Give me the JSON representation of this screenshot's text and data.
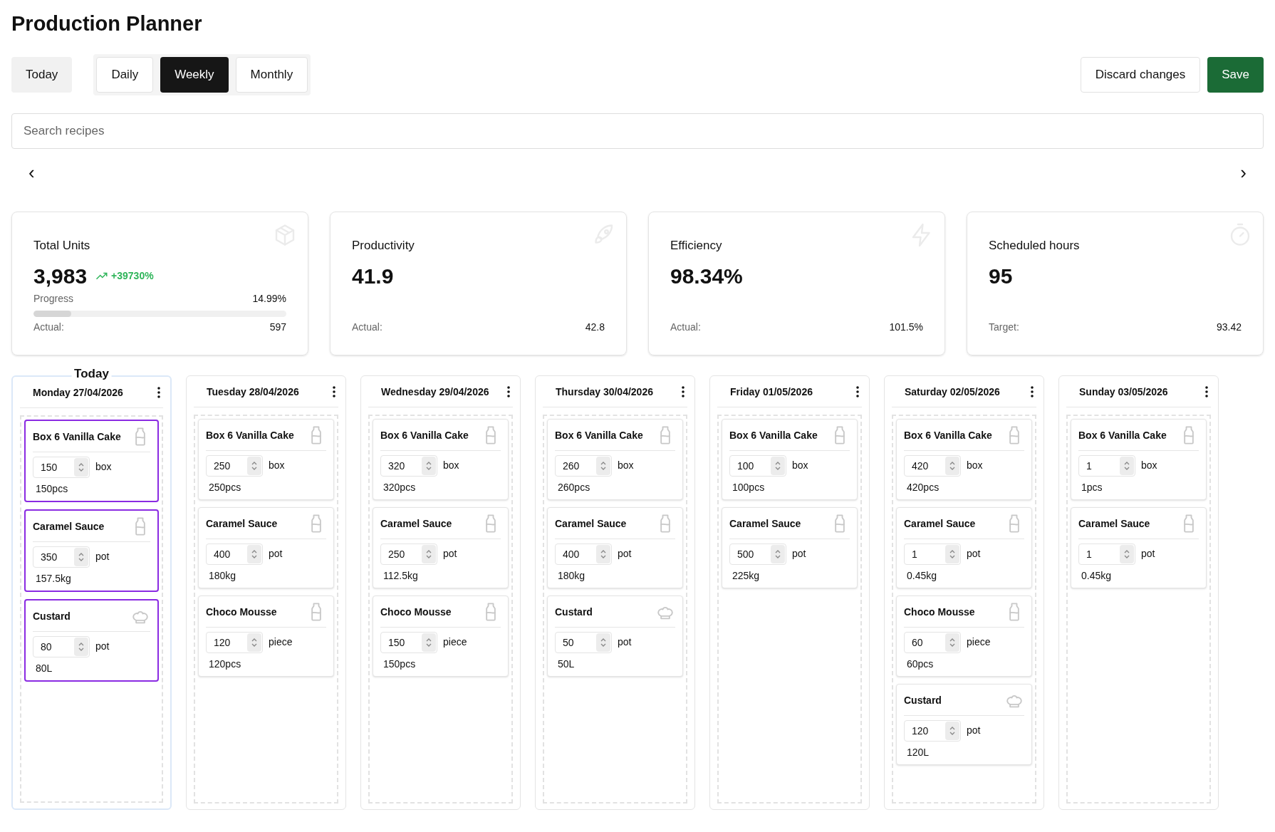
{
  "title": "Production Planner",
  "today_button": "Today",
  "tabs": [
    {
      "label": "Daily",
      "selected": false
    },
    {
      "label": "Weekly",
      "selected": true
    },
    {
      "label": "Monthly",
      "selected": false
    }
  ],
  "actions": [
    {
      "label": "Discard changes",
      "kind": "secondary"
    },
    {
      "label": "Save",
      "kind": "primary"
    }
  ],
  "search": {
    "placeholder": "Search recipes"
  },
  "nav": {
    "prev": "‹",
    "next": "›"
  },
  "stats": [
    {
      "title": "Total Units",
      "value": "3,983",
      "trend": "+39730%",
      "kind": "box",
      "progress": {
        "label": "Progress",
        "reading": "14.99%",
        "level": 0.1499
      },
      "footer_label": "Actual:",
      "footer_value": "597"
    },
    {
      "title": "Productivity",
      "value": "41.9",
      "kind": "rocket",
      "footer_label": "Actual:",
      "footer_value": "42.8"
    },
    {
      "title": "Efficiency",
      "value": "98.34%",
      "kind": "bolt",
      "footer_label": "Actual:",
      "footer_value": "101.5%"
    },
    {
      "title": "Scheduled hours",
      "value": "95",
      "kind": "timer",
      "footer_label": "Target:",
      "footer_value": "93.42"
    }
  ],
  "days": [
    {
      "label": "Monday 27/04/2026",
      "today": true,
      "today_label": "Today",
      "items": [
        {
          "name": "Box 6 Vanilla Cake",
          "kind": "bottle",
          "quantity": "150",
          "unit": "box",
          "total": "150pcs",
          "highlighted": true
        },
        {
          "name": "Caramel Sauce",
          "kind": "bottle",
          "quantity": "350",
          "unit": "pot",
          "total": "157.5kg",
          "highlighted": true
        },
        {
          "name": "Custard",
          "kind": "chef-hat",
          "quantity": "80",
          "unit": "pot",
          "total": "80L",
          "highlighted": true
        }
      ]
    },
    {
      "label": "Tuesday 28/04/2026",
      "today": false,
      "items": [
        {
          "name": "Box 6 Vanilla Cake",
          "kind": "bottle",
          "quantity": "250",
          "unit": "box",
          "total": "250pcs",
          "highlighted": false
        },
        {
          "name": "Caramel Sauce",
          "kind": "bottle",
          "quantity": "400",
          "unit": "pot",
          "total": "180kg",
          "highlighted": false
        },
        {
          "name": "Choco Mousse",
          "kind": "bottle",
          "quantity": "120",
          "unit": "piece",
          "total": "120pcs",
          "highlighted": false
        }
      ]
    },
    {
      "label": "Wednesday 29/04/2026",
      "today": false,
      "items": [
        {
          "name": "Box 6 Vanilla Cake",
          "kind": "bottle",
          "quantity": "320",
          "unit": "box",
          "total": "320pcs",
          "highlighted": false
        },
        {
          "name": "Caramel Sauce",
          "kind": "bottle",
          "quantity": "250",
          "unit": "pot",
          "total": "112.5kg",
          "highlighted": false
        },
        {
          "name": "Choco Mousse",
          "kind": "bottle",
          "quantity": "150",
          "unit": "piece",
          "total": "150pcs",
          "highlighted": false
        }
      ]
    },
    {
      "label": "Thursday 30/04/2026",
      "today": false,
      "items": [
        {
          "name": "Box 6 Vanilla Cake",
          "kind": "bottle",
          "quantity": "260",
          "unit": "box",
          "total": "260pcs",
          "highlighted": false
        },
        {
          "name": "Caramel Sauce",
          "kind": "bottle",
          "quantity": "400",
          "unit": "pot",
          "total": "180kg",
          "highlighted": false
        },
        {
          "name": "Custard",
          "kind": "chef-hat",
          "quantity": "50",
          "unit": "pot",
          "total": "50L",
          "highlighted": false
        }
      ]
    },
    {
      "label": "Friday 01/05/2026",
      "today": false,
      "items": [
        {
          "name": "Box 6 Vanilla Cake",
          "kind": "bottle",
          "quantity": "100",
          "unit": "box",
          "total": "100pcs",
          "highlighted": false
        },
        {
          "name": "Caramel Sauce",
          "kind": "bottle",
          "quantity": "500",
          "unit": "pot",
          "total": "225kg",
          "highlighted": false
        }
      ]
    },
    {
      "label": "Saturday 02/05/2026",
      "today": false,
      "items": [
        {
          "name": "Box 6 Vanilla Cake",
          "kind": "bottle",
          "quantity": "420",
          "unit": "box",
          "total": "420pcs",
          "highlighted": false
        },
        {
          "name": "Caramel Sauce",
          "kind": "bottle",
          "quantity": "1",
          "unit": "pot",
          "total": "0.45kg",
          "highlighted": false
        },
        {
          "name": "Choco Mousse",
          "kind": "bottle",
          "quantity": "60",
          "unit": "piece",
          "total": "60pcs",
          "highlighted": false
        },
        {
          "name": "Custard",
          "kind": "chef-hat",
          "quantity": "120",
          "unit": "pot",
          "total": "120L",
          "highlighted": false
        }
      ]
    },
    {
      "label": "Sunday 03/05/2026",
      "today": false,
      "items": [
        {
          "name": "Box 6 Vanilla Cake",
          "kind": "bottle",
          "quantity": "1",
          "unit": "box",
          "total": "1pcs",
          "highlighted": false
        },
        {
          "name": "Caramel Sauce",
          "kind": "bottle",
          "quantity": "1",
          "unit": "pot",
          "total": "0.45kg",
          "highlighted": false
        }
      ]
    }
  ]
}
